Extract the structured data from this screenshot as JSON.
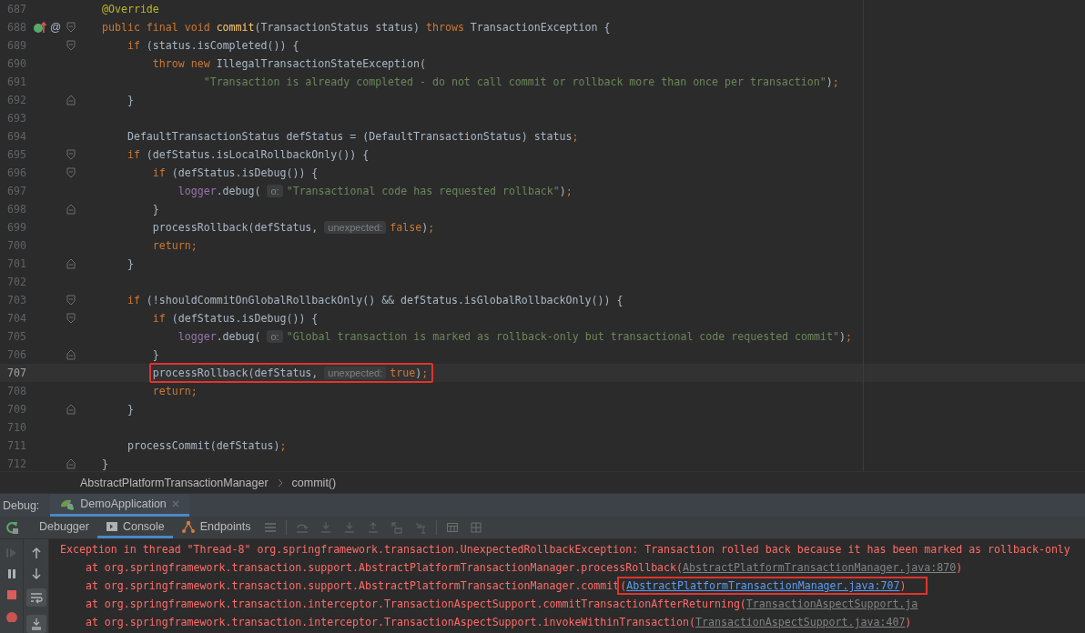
{
  "editor": {
    "lines": [
      {
        "number": "687",
        "current": false,
        "tokens": [
          {
            "kind": "annotation",
            "text": "@Override"
          }
        ]
      },
      {
        "number": "688",
        "current": false,
        "gutter": {
          "override_icon": true,
          "text": "@"
        },
        "fold": {
          "kind": "start"
        },
        "tokens": [
          {
            "kind": "kw",
            "text": "public final void "
          },
          {
            "kind": "method",
            "text": "commit"
          },
          {
            "kind": "plain",
            "text": "(TransactionStatus status) "
          },
          {
            "kind": "kw",
            "text": "throws"
          },
          {
            "kind": "plain",
            "text": " TransactionException {"
          }
        ]
      },
      {
        "number": "689",
        "current": false,
        "fold": {
          "kind": "start"
        },
        "tokens": [
          {
            "kind": "kw",
            "text": "    if"
          },
          {
            "kind": "plain",
            "text": " (status.isCompleted()) {"
          }
        ]
      },
      {
        "number": "690",
        "current": false,
        "tokens": [
          {
            "kind": "kw",
            "text": "        throw new"
          },
          {
            "kind": "plain",
            "text": " IllegalTransactionStateException("
          }
        ]
      },
      {
        "number": "691",
        "current": false,
        "tokens": [
          {
            "kind": "string",
            "text": "                \"Transaction is already completed - do not call commit or rollback more than once per transaction\""
          },
          {
            "kind": "plain",
            "text": ")"
          },
          {
            "kind": "kw",
            "text": ";"
          }
        ]
      },
      {
        "number": "692",
        "current": false,
        "fold": {
          "kind": "end"
        },
        "tokens": [
          {
            "kind": "plain",
            "text": "    }"
          }
        ]
      },
      {
        "number": "693",
        "current": false
      },
      {
        "number": "694",
        "current": false,
        "tokens": [
          {
            "kind": "plain",
            "text": "    DefaultTransactionStatus defStatus = (DefaultTransactionStatus) status"
          },
          {
            "kind": "kw",
            "text": ";"
          }
        ]
      },
      {
        "number": "695",
        "current": false,
        "fold": {
          "kind": "start"
        },
        "tokens": [
          {
            "kind": "kw",
            "text": "    if"
          },
          {
            "kind": "plain",
            "text": " (defStatus.isLocalRollbackOnly()) {"
          }
        ]
      },
      {
        "number": "696",
        "current": false,
        "fold": {
          "kind": "start"
        },
        "tokens": [
          {
            "kind": "kw",
            "text": "        if"
          },
          {
            "kind": "plain",
            "text": " (defStatus.isDebug()) {"
          }
        ]
      },
      {
        "number": "697",
        "current": false,
        "tokens": [
          {
            "kind": "field",
            "text": "            logger"
          },
          {
            "kind": "plain",
            "text": ".debug( "
          },
          {
            "kind": "hint",
            "text": "o:"
          },
          {
            "kind": "string",
            "text": "\"Transactional code has requested rollback\""
          },
          {
            "kind": "plain",
            "text": ")"
          },
          {
            "kind": "kw",
            "text": ";"
          }
        ]
      },
      {
        "number": "698",
        "current": false,
        "fold": {
          "kind": "end"
        },
        "tokens": [
          {
            "kind": "plain",
            "text": "        }"
          }
        ]
      },
      {
        "number": "699",
        "current": false,
        "tokens": [
          {
            "kind": "plain",
            "text": "        processRollback(defStatus, "
          },
          {
            "kind": "hint",
            "text": "unexpected:"
          },
          {
            "kind": "kw",
            "text": "false"
          },
          {
            "kind": "plain",
            "text": ")"
          },
          {
            "kind": "kw",
            "text": ";"
          }
        ]
      },
      {
        "number": "700",
        "current": false,
        "tokens": [
          {
            "kind": "kw",
            "text": "        return;"
          }
        ]
      },
      {
        "number": "701",
        "current": false,
        "fold": {
          "kind": "end"
        },
        "tokens": [
          {
            "kind": "plain",
            "text": "    }"
          }
        ]
      },
      {
        "number": "702",
        "current": false
      },
      {
        "number": "703",
        "current": false,
        "fold": {
          "kind": "start"
        },
        "tokens": [
          {
            "kind": "kw",
            "text": "    if"
          },
          {
            "kind": "plain",
            "text": " (!shouldCommitOnGlobalRollbackOnly() && defStatus.isGlobalRollbackOnly()) {"
          }
        ]
      },
      {
        "number": "704",
        "current": false,
        "fold": {
          "kind": "start"
        },
        "tokens": [
          {
            "kind": "kw",
            "text": "        if"
          },
          {
            "kind": "plain",
            "text": " (defStatus.isDebug()) {"
          }
        ]
      },
      {
        "number": "705",
        "current": false,
        "tokens": [
          {
            "kind": "field",
            "text": "            logger"
          },
          {
            "kind": "plain",
            "text": ".debug( "
          },
          {
            "kind": "hint",
            "text": "o:"
          },
          {
            "kind": "string",
            "text": "\"Global transaction is marked as rollback-only but transactional code requested commit\""
          },
          {
            "kind": "plain",
            "text": ")"
          },
          {
            "kind": "kw",
            "text": ";"
          }
        ]
      },
      {
        "number": "706",
        "current": false,
        "fold": {
          "kind": "end"
        },
        "tokens": [
          {
            "kind": "plain",
            "text": "        }"
          }
        ]
      },
      {
        "number": "707",
        "current": true,
        "tokens": [
          {
            "kind": "plain",
            "text": "        processRollback(defStatus, ",
            "boxed": true
          },
          {
            "kind": "hint",
            "text": "unexpected:",
            "boxed": true
          },
          {
            "kind": "kw",
            "text": "true",
            "boxed": true
          },
          {
            "kind": "plain",
            "text": ")",
            "boxed": true
          },
          {
            "kind": "kw",
            "text": ";",
            "boxed": true
          }
        ]
      },
      {
        "number": "708",
        "current": false,
        "tokens": [
          {
            "kind": "kw",
            "text": "        return;"
          }
        ]
      },
      {
        "number": "709",
        "current": false,
        "fold": {
          "kind": "end"
        },
        "tokens": [
          {
            "kind": "plain",
            "text": "    }"
          }
        ]
      },
      {
        "number": "710",
        "current": false
      },
      {
        "number": "711",
        "current": false,
        "tokens": [
          {
            "kind": "plain",
            "text": "    processCommit(defStatus)"
          },
          {
            "kind": "kw",
            "text": ";"
          }
        ]
      },
      {
        "number": "712",
        "current": false,
        "fold": {
          "kind": "end"
        },
        "tokens": [
          {
            "kind": "plain",
            "text": "}"
          }
        ]
      }
    ]
  },
  "breadcrumbs": [
    "AbstractPlatformTransactionManager",
    "commit()"
  ],
  "debug": {
    "label": "Debug:",
    "tabs": [
      {
        "label": "DemoApplication",
        "selected": true
      }
    ]
  },
  "tool_tabs": [
    {
      "label": "Debugger",
      "kind": "plain",
      "selected": false
    },
    {
      "label": "Console",
      "kind": "console",
      "selected": true
    },
    {
      "label": "Endpoints",
      "kind": "endpoints",
      "selected": false
    }
  ],
  "console": {
    "lines": [
      {
        "tokens": [
          {
            "kind": "err",
            "text": "Exception in thread \"Thread-8\" org.springframework.transaction.UnexpectedRollbackException: Transaction rolled back because it has been marked as rollback-only"
          }
        ]
      },
      {
        "tokens": [
          {
            "kind": "err",
            "text": "    at org.springframework.transaction.support.AbstractPlatformTransactionManager.processRollback("
          },
          {
            "kind": "link",
            "text": "AbstractPlatformTransactionManager.java:870",
            "active": false
          },
          {
            "kind": "err",
            "text": ")"
          }
        ]
      },
      {
        "tokens": [
          {
            "kind": "err",
            "text": "    at org.springframework.transaction.support.AbstractPlatformTransactionManager.commit"
          },
          {
            "kind": "err",
            "text": "(",
            "boxed": true
          },
          {
            "kind": "link",
            "text": "AbstractPlatformTransactionManager.java:707",
            "active": true,
            "boxed": true
          },
          {
            "kind": "err",
            "text": ")",
            "boxed": true
          }
        ]
      },
      {
        "tokens": [
          {
            "kind": "err",
            "text": "    at org.springframework.transaction.interceptor.TransactionAspectSupport.commitTransactionAfterReturning("
          },
          {
            "kind": "link",
            "text": "TransactionAspectSupport.ja",
            "active": false
          }
        ]
      },
      {
        "tokens": [
          {
            "kind": "err",
            "text": "    at org.springframework.transaction.interceptor.TransactionAspectSupport.invokeWithinTransaction("
          },
          {
            "kind": "link",
            "text": "TransactionAspectSupport.java:407",
            "active": false
          },
          {
            "kind": "err",
            "text": ")"
          }
        ]
      }
    ]
  }
}
